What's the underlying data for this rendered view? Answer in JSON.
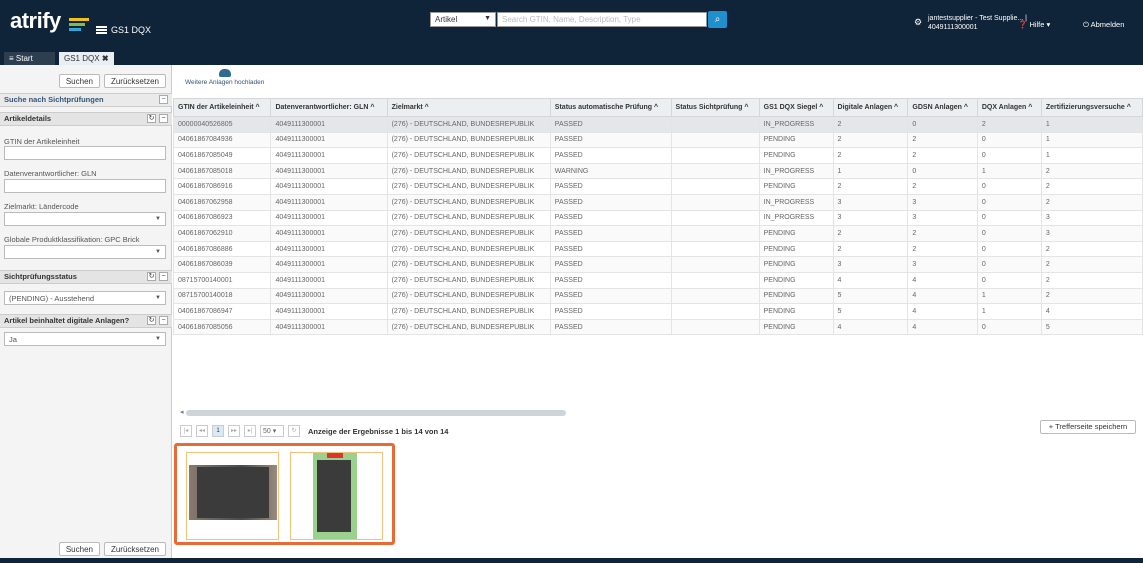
{
  "app": {
    "logo": "atrify",
    "module": "GS1 DQX"
  },
  "search": {
    "scope": "Artikel",
    "placeholder": "Search GTIN, Name, Description, Type"
  },
  "user": {
    "name": "jantestsupplier - Test Supplie... |",
    "gln": "4049111300001"
  },
  "header_menu": {
    "help": "Hilfe ▾",
    "logout": "Abmelden"
  },
  "tabs": [
    {
      "label": "Start"
    },
    {
      "label": "GS1 DQX"
    }
  ],
  "sidebar": {
    "search_btn": "Suchen",
    "reset_btn": "Zurücksetzen",
    "saved_search": "Suche nach Sichtprüfungen",
    "sec_article": "Artikeldetails",
    "label_gtin": "GTIN der Artikeleinheit",
    "label_gln": "Datenverantwortlicher: GLN",
    "label_market": "Zielmarkt: Ländercode",
    "label_gpc": "Globale Produktklassifikation: GPC Brick",
    "sec_status": "Sichtprüfungsstatus",
    "status_value": "(PENDING) - Ausstehend",
    "sec_digital": "Artikel beinhaltet digitale Anlagen?",
    "digital_value": "Ja"
  },
  "toolbar": {
    "upload": "Weitere Anlagen hochladen"
  },
  "table": {
    "headers": [
      "GTIN der Artikeleinheit ^",
      "Datenverantwortlicher: GLN ^",
      "Zielmarkt ^",
      "Status automatische Prüfung ^",
      "Status Sichtprüfung ^",
      "GS1 DQX Siegel ^",
      "Digitale Anlagen ^",
      "GDSN Anlagen ^",
      "DQX Anlagen ^",
      "Zertifizierungsversuche ^"
    ],
    "rows": [
      [
        "00000040526805",
        "4049111300001",
        "(276) - DEUTSCHLAND, BUNDESREPUBLIK",
        "PASSED",
        "",
        "IN_PROGRESS",
        "2",
        "0",
        "2",
        "1"
      ],
      [
        "04061867084936",
        "4049111300001",
        "(276) - DEUTSCHLAND, BUNDESREPUBLIK",
        "PASSED",
        "",
        "PENDING",
        "2",
        "2",
        "0",
        "1"
      ],
      [
        "04061867085049",
        "4049111300001",
        "(276) - DEUTSCHLAND, BUNDESREPUBLIK",
        "PASSED",
        "",
        "PENDING",
        "2",
        "2",
        "0",
        "1"
      ],
      [
        "04061867085018",
        "4049111300001",
        "(276) - DEUTSCHLAND, BUNDESREPUBLIK",
        "WARNING",
        "",
        "IN_PROGRESS",
        "1",
        "0",
        "1",
        "2"
      ],
      [
        "04061867086916",
        "4049111300001",
        "(276) - DEUTSCHLAND, BUNDESREPUBLIK",
        "PASSED",
        "",
        "PENDING",
        "2",
        "2",
        "0",
        "2"
      ],
      [
        "04061867062958",
        "4049111300001",
        "(276) - DEUTSCHLAND, BUNDESREPUBLIK",
        "PASSED",
        "",
        "IN_PROGRESS",
        "3",
        "3",
        "0",
        "2"
      ],
      [
        "04061867086923",
        "4049111300001",
        "(276) - DEUTSCHLAND, BUNDESREPUBLIK",
        "PASSED",
        "",
        "IN_PROGRESS",
        "3",
        "3",
        "0",
        "3"
      ],
      [
        "04061867062910",
        "4049111300001",
        "(276) - DEUTSCHLAND, BUNDESREPUBLIK",
        "PASSED",
        "",
        "PENDING",
        "2",
        "2",
        "0",
        "3"
      ],
      [
        "04061867086886",
        "4049111300001",
        "(276) - DEUTSCHLAND, BUNDESREPUBLIK",
        "PASSED",
        "",
        "PENDING",
        "2",
        "2",
        "0",
        "2"
      ],
      [
        "04061867086039",
        "4049111300001",
        "(276) - DEUTSCHLAND, BUNDESREPUBLIK",
        "PASSED",
        "",
        "PENDING",
        "3",
        "3",
        "0",
        "2"
      ],
      [
        "08715700140001",
        "4049111300001",
        "(276) - DEUTSCHLAND, BUNDESREPUBLIK",
        "PASSED",
        "",
        "PENDING",
        "4",
        "4",
        "0",
        "2"
      ],
      [
        "08715700140018",
        "4049111300001",
        "(276) - DEUTSCHLAND, BUNDESREPUBLIK",
        "PASSED",
        "",
        "PENDING",
        "5",
        "4",
        "1",
        "2"
      ],
      [
        "04061867086947",
        "4049111300001",
        "(276) - DEUTSCHLAND, BUNDESREPUBLIK",
        "PASSED",
        "",
        "PENDING",
        "5",
        "4",
        "1",
        "4"
      ],
      [
        "04061867085056",
        "4049111300001",
        "(276) - DEUTSCHLAND, BUNDESREPUBLIK",
        "PASSED",
        "",
        "PENDING",
        "4",
        "4",
        "0",
        "5"
      ]
    ]
  },
  "pager": {
    "page": "1",
    "page_size": "50",
    "results": "Anzeige der Ergebnisse 1 bis 14 von 14",
    "save": "Trefferseite speichern"
  }
}
